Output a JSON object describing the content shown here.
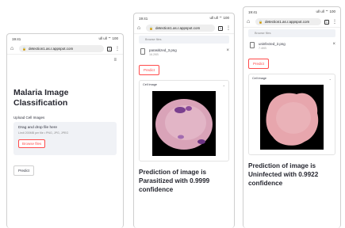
{
  "status": {
    "time": "19:41",
    "signal": "ull ull ⌔ 100"
  },
  "browser": {
    "url": "detection1.as.r.appspot.com",
    "tab_count": "1"
  },
  "screen1": {
    "title_line1": "Malaria Image",
    "title_line2": "Classification",
    "upload_label": "Upload Cell Images",
    "drop_title": "Drag and drop file here",
    "drop_limit": "Limit 200MB per file • PNG, JPG, JPEG",
    "browse_label": "Browse files",
    "predict_label": "Predict"
  },
  "screen2": {
    "browse_label": "Browse files",
    "file_name": "parasitized_3.png",
    "file_size": "16.2KB",
    "predict_label": "Predict",
    "expander_label": "Cell image",
    "result_line1": "Prediction of image is",
    "result_line2": "Parasitized with 0.9999",
    "result_line3": "confidence"
  },
  "screen3": {
    "browse_label": "Browse files",
    "file_name": "uninfected_2.png",
    "file_size": "7.4KB",
    "predict_label": "Predict",
    "expander_label": "Cell image",
    "result_line1": "Prediction of image is",
    "result_line2": "Uninfected with 0.9922",
    "result_line3": "confidence"
  },
  "colors": {
    "accent": "#ff4b4b",
    "panel": "#f0f2f6",
    "text": "#262730",
    "cell_parasitized": "#d9a3b8",
    "cell_uninfected": "#e7a6ad"
  },
  "icons": [
    "home-icon",
    "lock-icon",
    "tab-icon",
    "menu-dots-icon",
    "hamburger-icon",
    "file-icon",
    "close-icon",
    "chevron-down-icon"
  ]
}
